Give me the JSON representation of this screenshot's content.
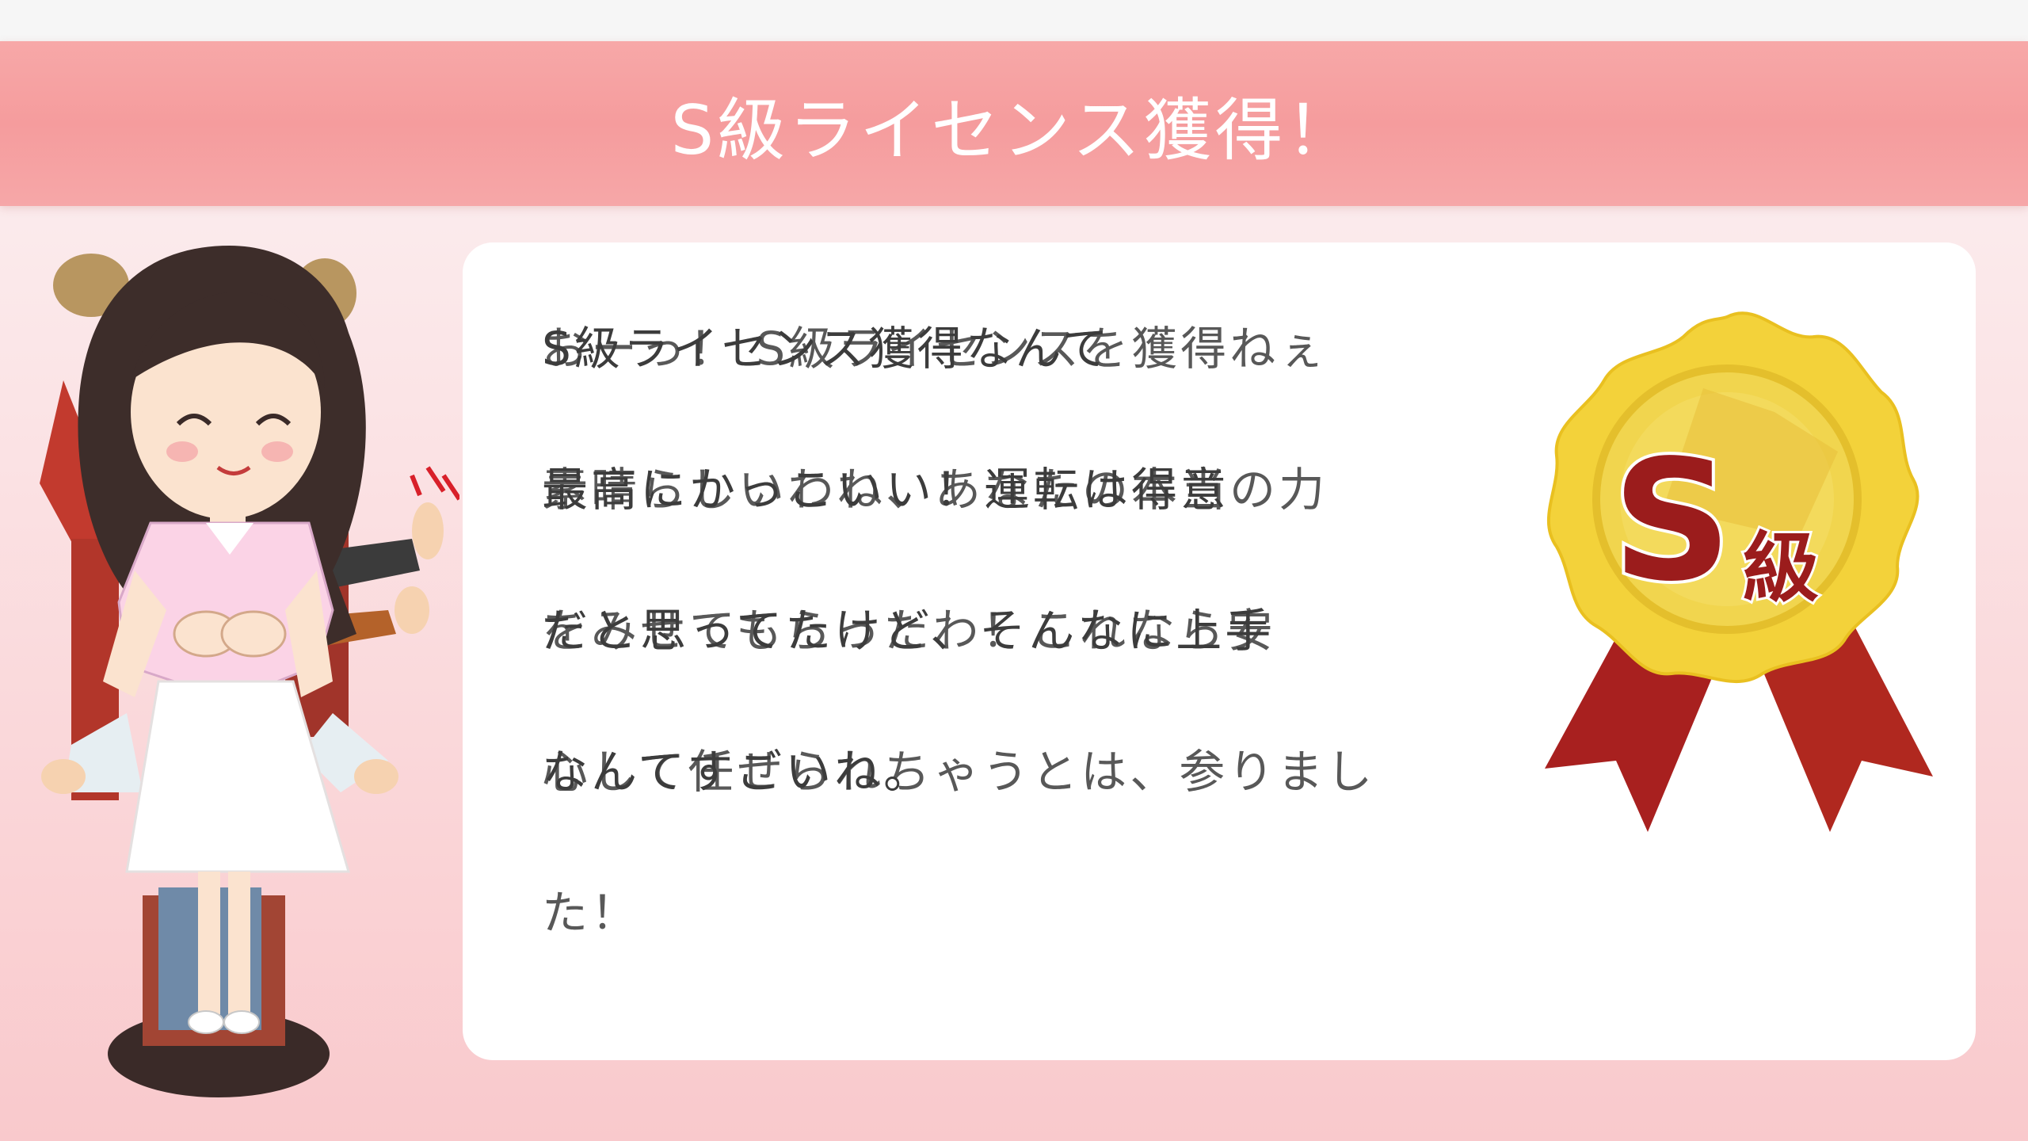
{
  "header": {
    "title": "S級ライセンス獲得！"
  },
  "message": {
    "lines": [
      {
        "main": "S級ライセンス獲得なんて",
        "ghost": "おーっ！ S級ライセンスを獲得ねぇ"
      },
      {
        "main": "最高にかっこいい！運転は得意",
        "ghost": "素晴らしいわね、あなたの本当の力"
      },
      {
        "main": "だと思ってたけど、そんなに上手",
        "ghost": "をみせてもらったわ！これなら安"
      },
      {
        "main": "なんてすごいね。",
        "ghost": "心して任せられちゃうとは、参りまし"
      },
      {
        "main": "",
        "ghost": "た！"
      }
    ]
  },
  "medal": {
    "label_big": "S",
    "label_small": "級"
  },
  "colors": {
    "banner": "#f59c9d",
    "medal_gold": "#f3d23a",
    "ribbon": "#a8201f",
    "medal_text": "#9b1c1c"
  }
}
